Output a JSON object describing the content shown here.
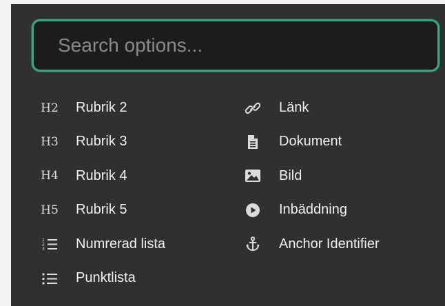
{
  "search": {
    "placeholder": "Search options..."
  },
  "left_items": [
    {
      "icon_text": "H2",
      "icon": "heading-2-icon",
      "label": "Rubrik 2"
    },
    {
      "icon_text": "H3",
      "icon": "heading-3-icon",
      "label": "Rubrik 3"
    },
    {
      "icon_text": "H4",
      "icon": "heading-4-icon",
      "label": "Rubrik 4"
    },
    {
      "icon_text": "H5",
      "icon": "heading-5-icon",
      "label": "Rubrik 5"
    },
    {
      "icon": "numbered-list-icon",
      "label": "Numrerad lista"
    },
    {
      "icon": "bullet-list-icon",
      "label": "Punktlista"
    }
  ],
  "right_items": [
    {
      "icon": "link-icon",
      "label": "Länk"
    },
    {
      "icon": "document-icon",
      "label": "Dokument"
    },
    {
      "icon": "image-icon",
      "label": "Bild"
    },
    {
      "icon": "play-icon",
      "label": "Inbäddning"
    },
    {
      "icon": "anchor-icon",
      "label": "Anchor Identifier"
    }
  ],
  "colors": {
    "panel_bg": "#303030",
    "search_bg": "#1c1c1c",
    "accent_border": "#3aa67d",
    "text": "#f0f0f0",
    "placeholder": "#8a8a8a"
  }
}
